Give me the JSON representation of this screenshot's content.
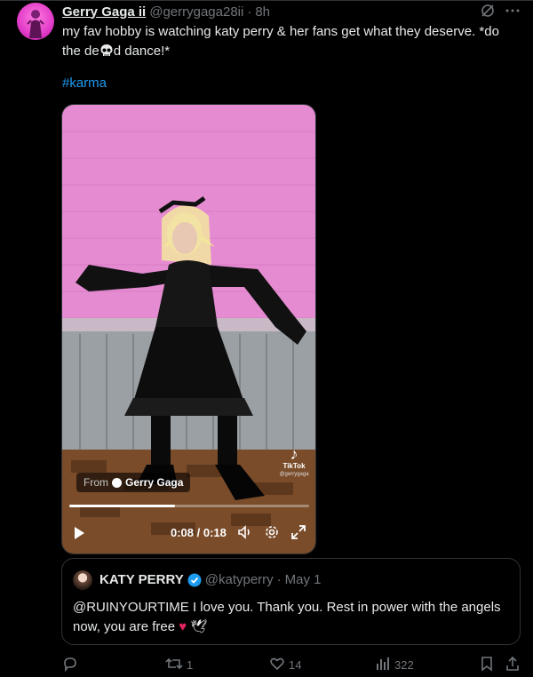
{
  "tweet": {
    "author_name": "Gerry Gaga ii",
    "author_handle": "@gerrygaga28ii",
    "separator": "·",
    "time": "8h",
    "text_before_emoji": "my fav hobby is watching katy perry & her fans get what they deserve. *do the de",
    "text_after_emoji": "d dance!*",
    "emoji_icon": "skull-emoji",
    "hashtag": "#karma"
  },
  "video": {
    "from_label": "From",
    "from_name": "Gerry Gaga",
    "watermark": "TikTok",
    "watermark_handle": "@gerrygaga",
    "progress": 0.44,
    "timecode": "0:08 / 0:18"
  },
  "quote": {
    "author_name": "KATY PERRY",
    "author_handle": "@katyperry",
    "separator": "·",
    "date": "May 1",
    "text": "@RUINYOURTIME I love you. Thank you. Rest in power with the angels now, you are free",
    "heart": "♥",
    "dove": "🕊",
    "verified_color": "#1d9bf0"
  },
  "actions": {
    "replies": "",
    "retweets": "1",
    "likes": "14",
    "views": "322"
  },
  "colors": {
    "accent": "#1d9bf0",
    "muted": "#71767b",
    "background": "#000000"
  }
}
